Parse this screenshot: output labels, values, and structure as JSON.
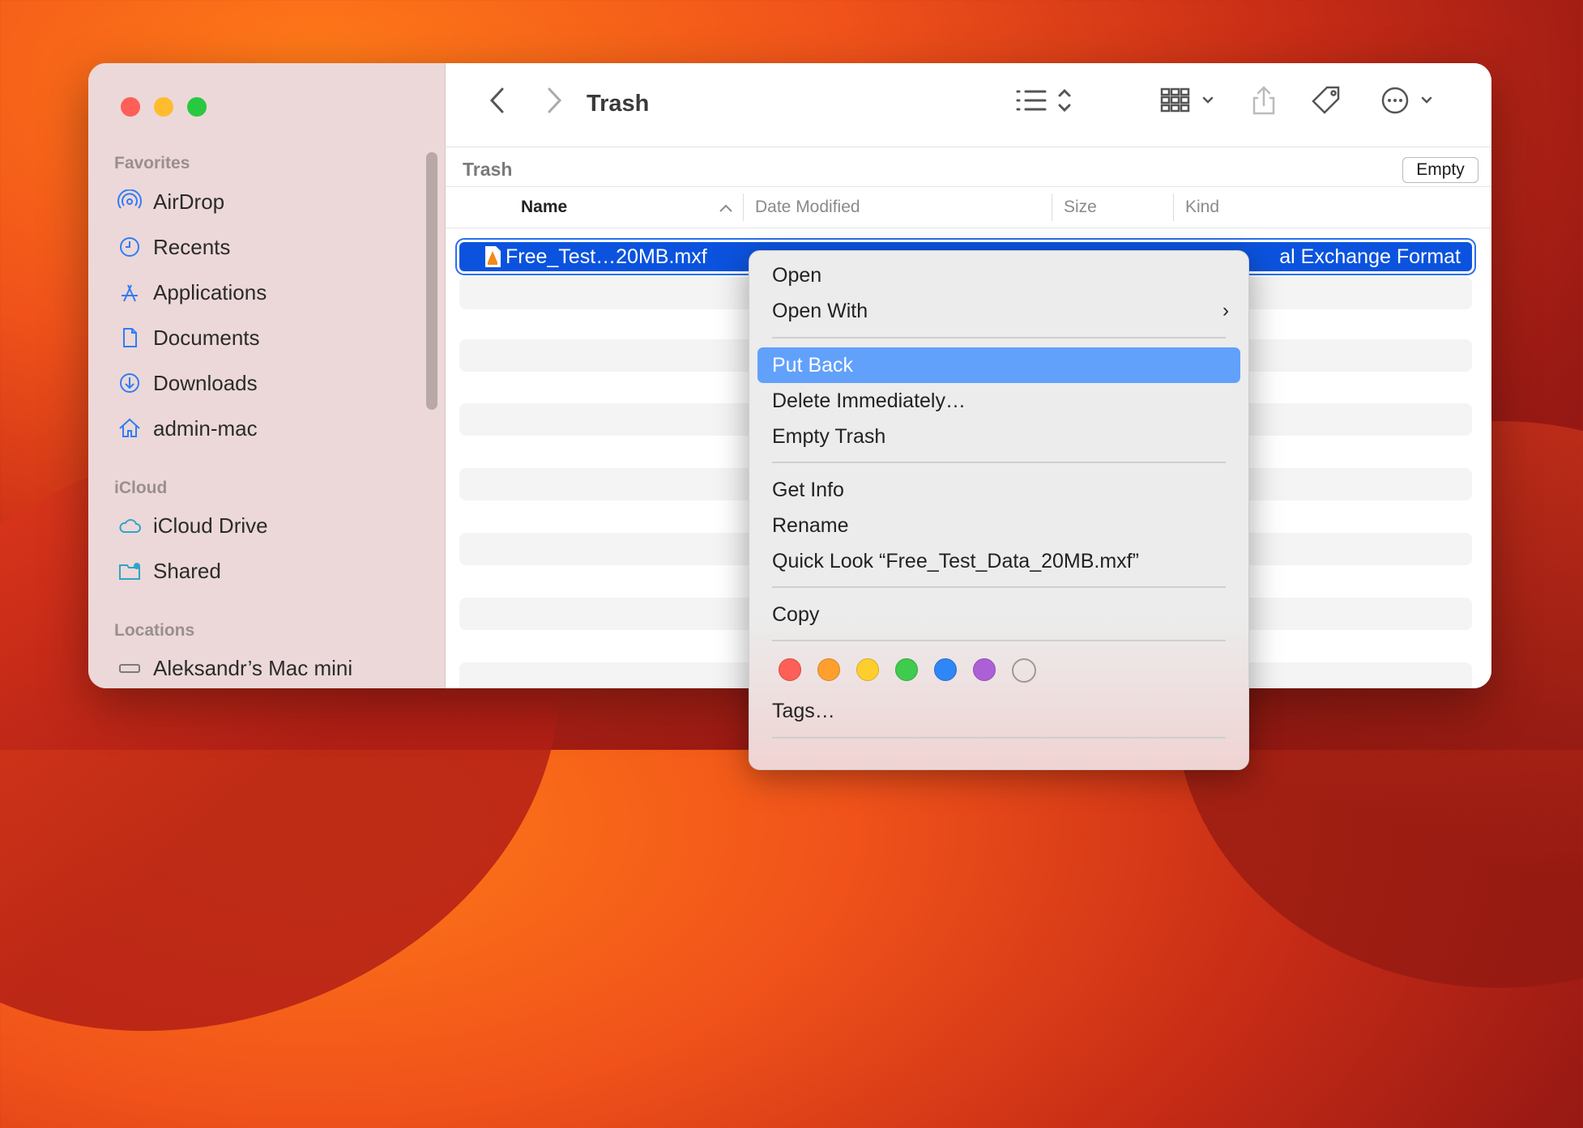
{
  "window": {
    "title": "Trash"
  },
  "sidebar": {
    "favorites_label": "Favorites",
    "favorites": [
      {
        "label": "AirDrop",
        "icon": "airdrop-icon"
      },
      {
        "label": "Recents",
        "icon": "clock-icon"
      },
      {
        "label": "Applications",
        "icon": "applications-icon"
      },
      {
        "label": "Documents",
        "icon": "document-icon"
      },
      {
        "label": "Downloads",
        "icon": "download-icon"
      },
      {
        "label": "admin-mac",
        "icon": "home-icon"
      }
    ],
    "icloud_label": "iCloud",
    "icloud": [
      {
        "label": "iCloud Drive",
        "icon": "cloud-icon"
      },
      {
        "label": "Shared",
        "icon": "shared-folder-icon"
      }
    ],
    "locations_label": "Locations",
    "locations": [
      {
        "label": "Aleksandr’s Mac mini",
        "icon": "computer-icon"
      }
    ]
  },
  "pathbar": {
    "label": "Trash",
    "empty_button": "Empty"
  },
  "columns": {
    "name": "Name",
    "date": "Date Modified",
    "size": "Size",
    "kind": "Kind"
  },
  "file": {
    "name": "Free_Test…20MB.mxf",
    "kind_visible": "al Exchange Format"
  },
  "context_menu": {
    "open": "Open",
    "open_with": "Open With",
    "put_back": "Put Back",
    "delete_immediately": "Delete Immediately…",
    "empty_trash": "Empty Trash",
    "get_info": "Get Info",
    "rename": "Rename",
    "quick_look": "Quick Look “Free_Test_Data_20MB.mxf”",
    "copy": "Copy",
    "tags": "Tags…",
    "tag_colors": [
      "#fe5f57",
      "#fe9f2e",
      "#fece2e",
      "#3fcb4e",
      "#2f86f6",
      "#ad5fd8",
      "#d8d8d8"
    ]
  },
  "colors": {
    "selection": "#0b53de",
    "menu_highlight": "#61a1fb",
    "accent": "#2f7cf6"
  }
}
